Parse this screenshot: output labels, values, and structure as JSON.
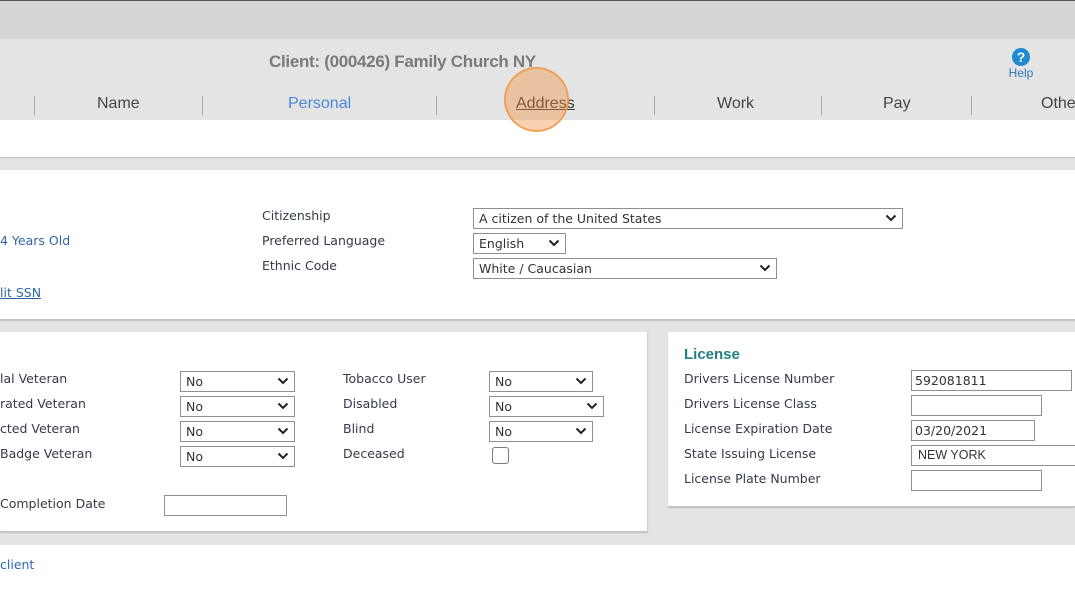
{
  "header": {
    "client_title": "Client: (000426) Family Church NY",
    "help_label": "Help",
    "help_icon": "question-circle-icon"
  },
  "tabs": [
    {
      "label": "Name",
      "state": "normal"
    },
    {
      "label": "Personal",
      "state": "active"
    },
    {
      "label": "Address",
      "state": "hover"
    },
    {
      "label": "Work",
      "state": "normal"
    },
    {
      "label": "Pay",
      "state": "normal"
    },
    {
      "label": "Othe",
      "state": "normal"
    }
  ],
  "personal": {
    "age_text": "4 Years Old",
    "edit_ssn_link": "lit SSN",
    "citizenship": {
      "label": "Citizenship",
      "value": "A citizen of the United States"
    },
    "preferred_language": {
      "label": "Preferred Language",
      "value": "English"
    },
    "ethnic_code": {
      "label": "Ethnic Code",
      "value": "White / Caucasian"
    }
  },
  "veteran": {
    "rows": [
      {
        "label": "lal Veteran",
        "value": "No"
      },
      {
        "label": "rated Veteran",
        "value": "No"
      },
      {
        "label": "cted Veteran",
        "value": "No"
      },
      {
        "label": " Badge Veteran",
        "value": "No"
      }
    ],
    "completion_date_label": " Completion Date",
    "completion_date_value": ""
  },
  "health": {
    "tobacco_user": {
      "label": "Tobacco User",
      "value": "No"
    },
    "disabled": {
      "label": "Disabled",
      "value": "No"
    },
    "blind": {
      "label": "Blind",
      "value": "No"
    },
    "deceased": {
      "label": "Deceased",
      "checked": false
    }
  },
  "license": {
    "title": "License",
    "drivers_license_number": {
      "label": "Drivers License Number",
      "value": "592081811"
    },
    "drivers_license_class": {
      "label": "Drivers License Class",
      "value": ""
    },
    "license_expiration_date": {
      "label": "License Expiration Date",
      "value": "03/20/2021"
    },
    "state_issuing_license": {
      "label": "State Issuing License",
      "value": "NEW YORK"
    },
    "license_plate_number": {
      "label": "License Plate Number",
      "value": ""
    }
  },
  "footer": {
    "client_link": "client"
  },
  "colors": {
    "active_tab": "#4a87d8",
    "section_title": "#1f7f86",
    "link": "#2f66a8",
    "help_icon": "#1e8bd0"
  }
}
